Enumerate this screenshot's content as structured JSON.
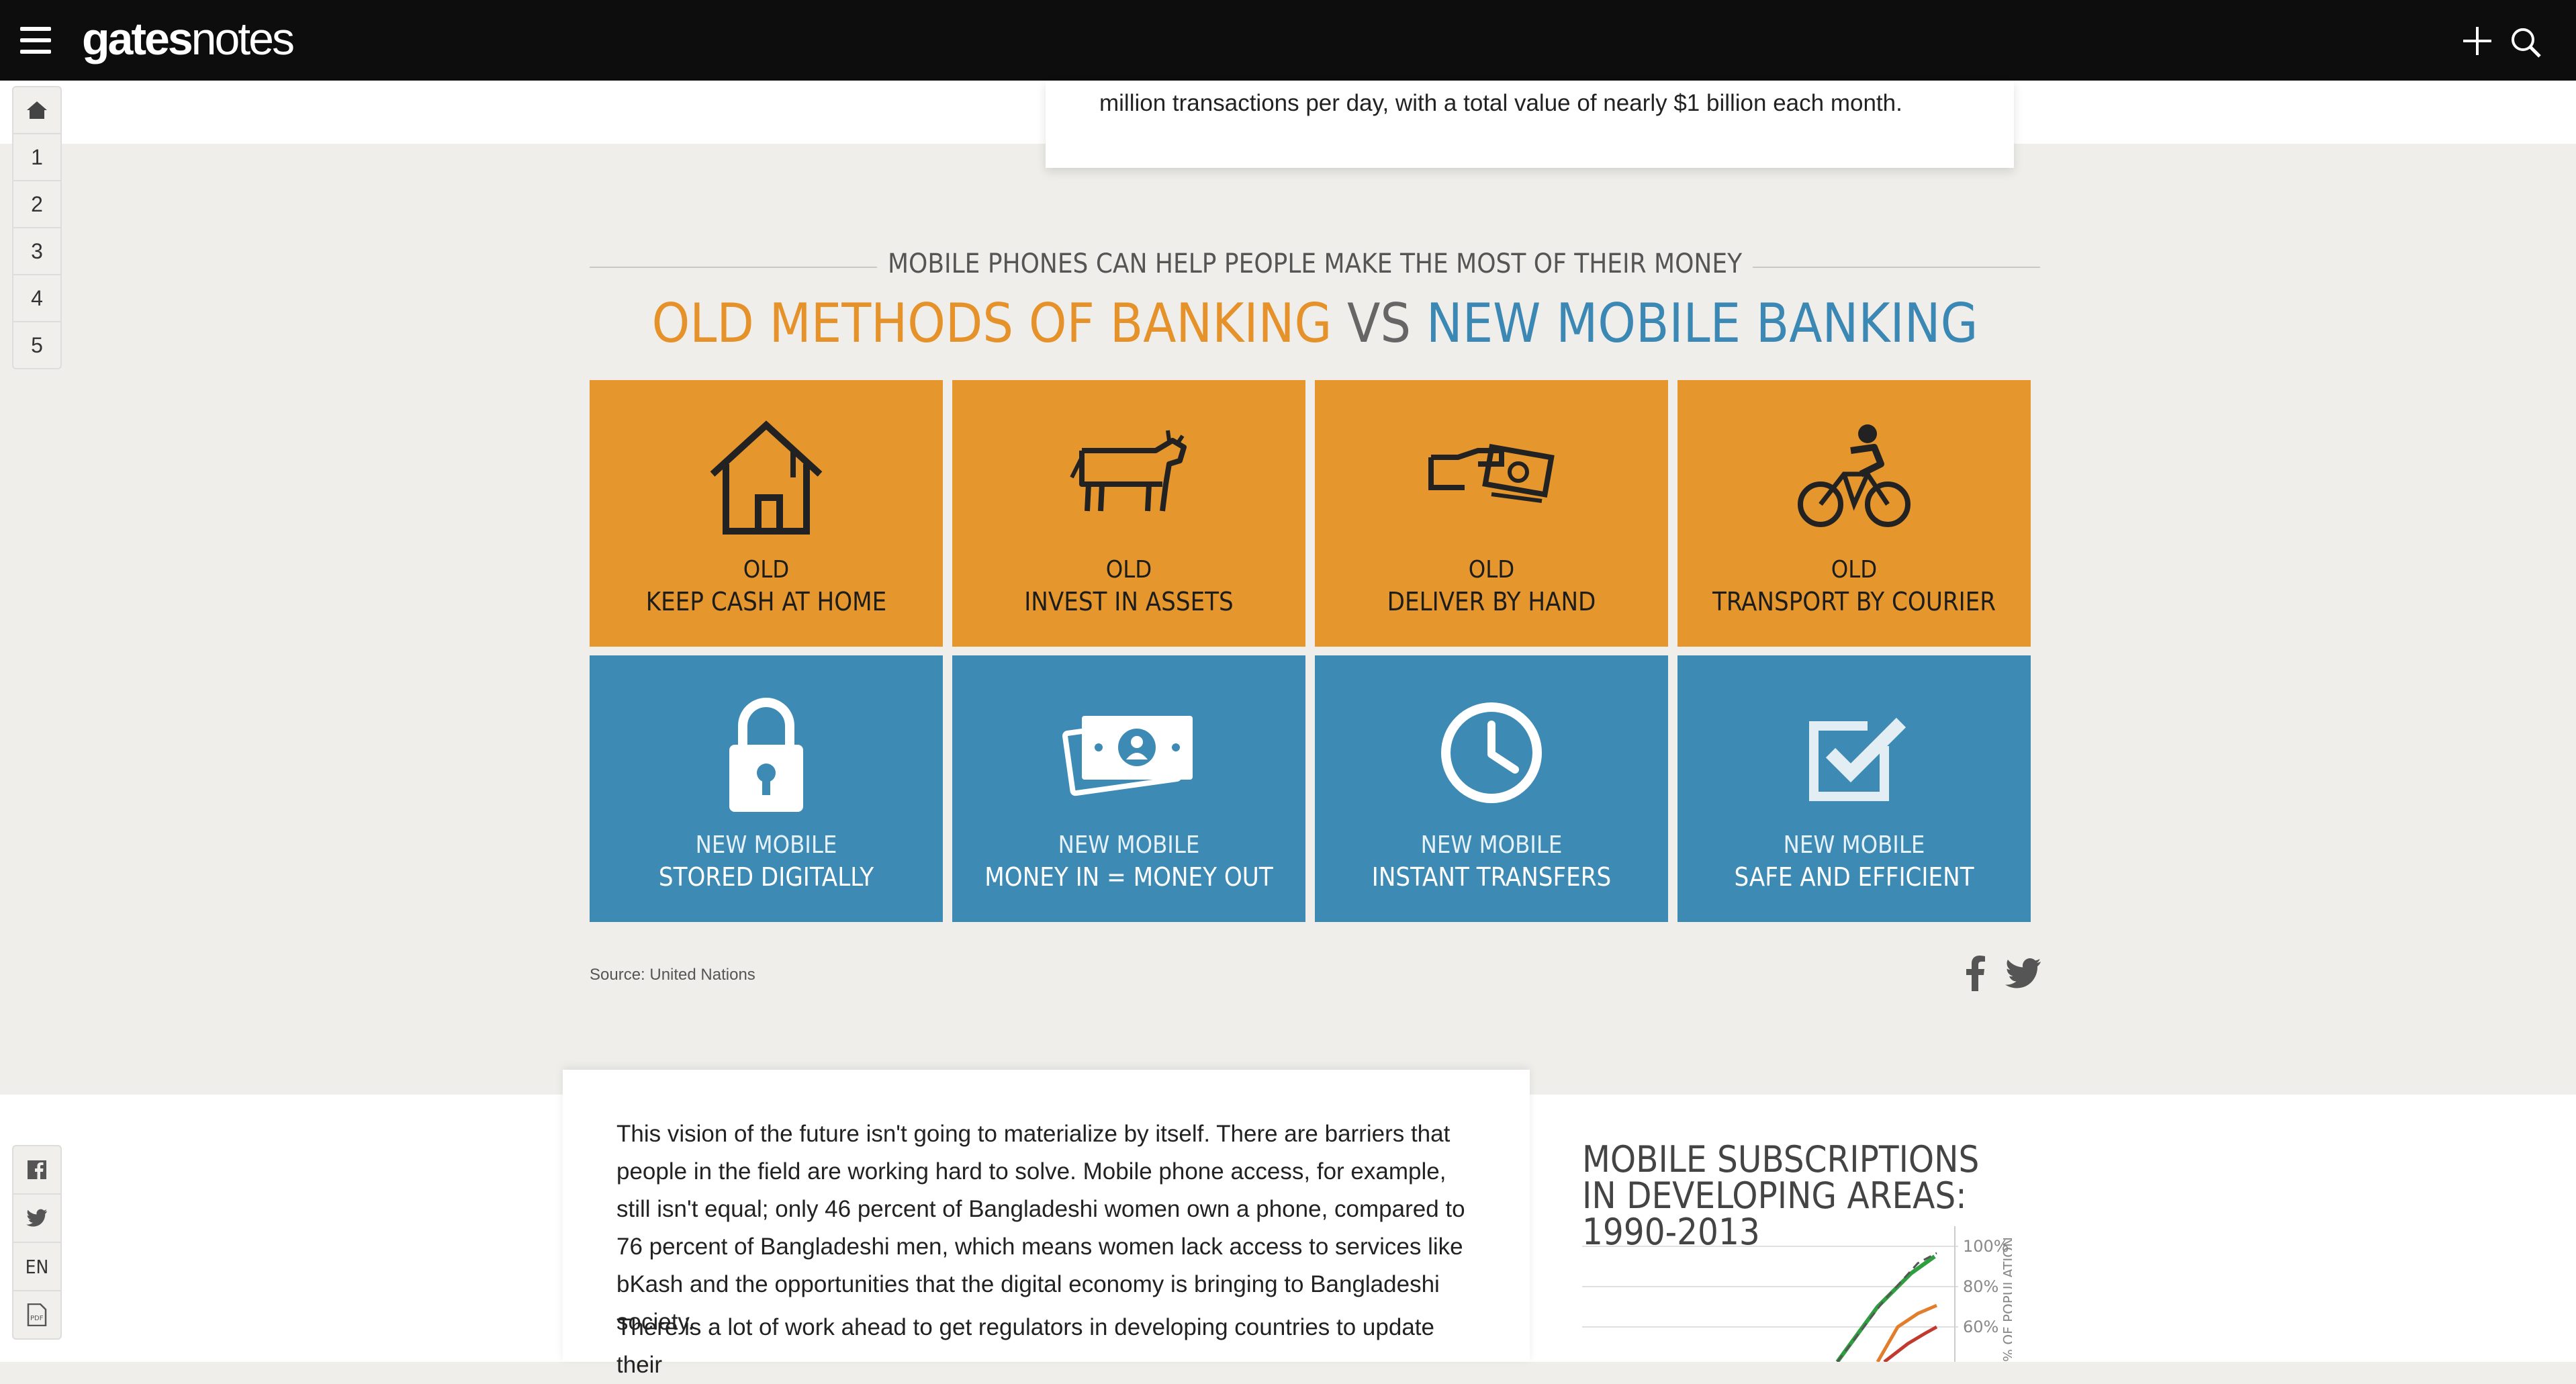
{
  "header": {
    "logo_bold": "gates",
    "logo_light": "notes"
  },
  "sidebar_top": {
    "items": [
      "1",
      "2",
      "3",
      "4",
      "5"
    ]
  },
  "sidebar_bottom": {
    "lang": "EN",
    "pdf": "PDF"
  },
  "upper_card": {
    "text": "million transactions per day, with a total value of nearly $1 billion each month."
  },
  "infographic": {
    "subtitle": "MOBILE PHONES CAN HELP PEOPLE MAKE THE MOST OF THEIR MONEY",
    "headline_old": "OLD METHODS OF BANKING",
    "headline_vs": " VS ",
    "headline_new": "NEW MOBILE BANKING",
    "old_tiles": [
      {
        "kind": "OLD",
        "label": "KEEP CASH AT HOME",
        "icon": "house-icon"
      },
      {
        "kind": "OLD",
        "label": "INVEST IN ASSETS",
        "icon": "cow-icon"
      },
      {
        "kind": "OLD",
        "label": "DELIVER BY HAND",
        "icon": "hand-cash-icon"
      },
      {
        "kind": "OLD",
        "label": "TRANSPORT BY COURIER",
        "icon": "cyclist-icon"
      }
    ],
    "new_tiles": [
      {
        "kind": "NEW MOBILE",
        "label": "STORED DIGITALLY",
        "icon": "padlock-icon"
      },
      {
        "kind": "NEW MOBILE",
        "label": "MONEY IN = MONEY OUT",
        "icon": "banknotes-icon"
      },
      {
        "kind": "NEW MOBILE",
        "label": "INSTANT TRANSFERS",
        "icon": "clock-icon"
      },
      {
        "kind": "NEW MOBILE",
        "label": "SAFE AND EFFICIENT",
        "icon": "checkbox-icon"
      }
    ],
    "source": "Source: United Nations",
    "colors": {
      "old": "#e5962d",
      "new": "#3d8bb5",
      "headline_old": "#e5922b",
      "headline_new": "#3c88b4"
    }
  },
  "lower_card": {
    "para1": "This vision of the future isn't going to materialize by itself. There are barriers that people in the field are working hard to solve. Mobile phone access, for example, still isn't equal; only 46 percent of Bangladeshi women own a phone, compared to 76 percent of Bangladeshi men, which means women lack access to services like bKash and the opportunities that the digital economy is bringing to Bangladeshi society.",
    "para2": "There is a lot of work ahead to get regulators in developing countries to update their"
  },
  "side_chart": {
    "title": "MOBILE SUBSCRIPTIONS IN DEVELOPING AREAS: 1990-2013",
    "ticks": [
      "100%",
      "80%",
      "60%"
    ],
    "axis_label": "% OF POPULATION"
  }
}
